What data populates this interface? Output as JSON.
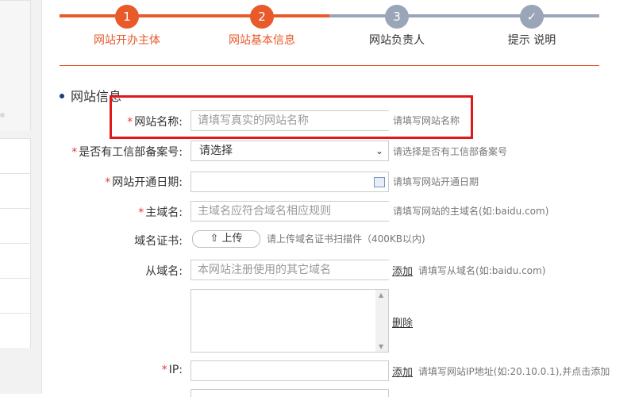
{
  "steps": [
    {
      "number": "1",
      "label": "网站开办主体",
      "state": "done"
    },
    {
      "number": "2",
      "label": "网站基本信息",
      "state": "active"
    },
    {
      "number": "3",
      "label": "网站负责人",
      "state": "pending"
    },
    {
      "number": "✓",
      "label": "提示 说明",
      "state": "pending"
    }
  ],
  "colors": {
    "accent": "#e85a2a",
    "pending": "#9aa6b8",
    "required": "#e4393c",
    "highlight": "#e0181c"
  },
  "section": {
    "title": "网站信息"
  },
  "form": {
    "site_name": {
      "label": "网站名称:",
      "placeholder": "请填写真实的网站名称",
      "hint": "请填写网站名称"
    },
    "icp_record": {
      "label": "是否有工信部备案号:",
      "value": "请选择",
      "hint": "请选择是否有工信部备案号"
    },
    "open_date": {
      "label": "网站开通日期:",
      "hint": "请填写网站开通日期"
    },
    "main_domain": {
      "label": "主域名:",
      "placeholder": "主域名应符合域名相应规则",
      "hint": "请填写网站的主域名(如:baidu.com)"
    },
    "domain_cert": {
      "label": "域名证书:",
      "button": "上传",
      "hint": "请上传域名证书扫描件（400KB以内)"
    },
    "sub_domain": {
      "label": "从域名:",
      "placeholder": "本网站注册使用的其它域名",
      "add": "添加",
      "hint": "请填写从域名(如:baidu.com)",
      "delete": "删除"
    },
    "ip": {
      "label": "IP:",
      "add": "添加",
      "hint": "请填写网站IP地址(如:20.10.0.1),并点击添加"
    }
  }
}
